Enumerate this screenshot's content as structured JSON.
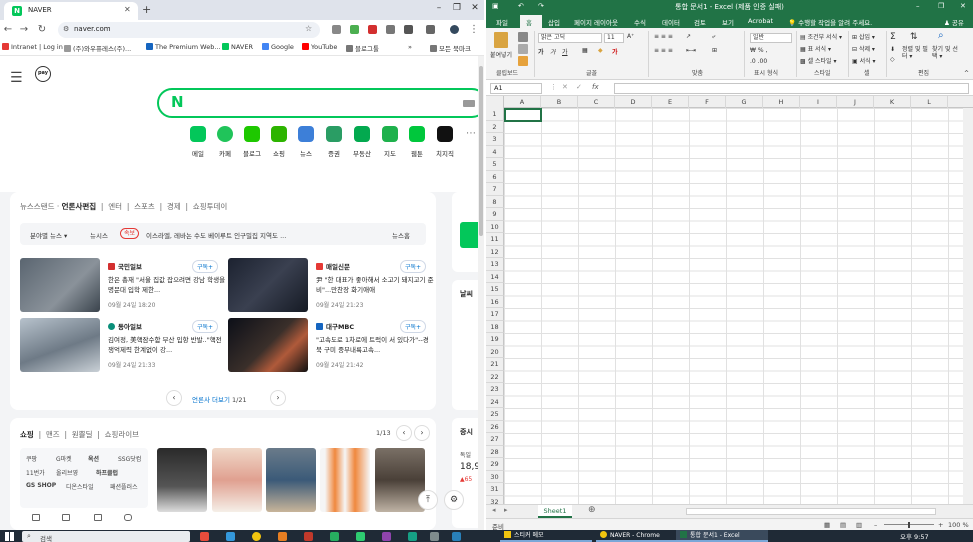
{
  "chrome": {
    "tab_title": "NAVER",
    "url": "naver.com",
    "bookmarks": [
      "Intranet | Log in",
      "(주)와우퓨레스(주)...",
      "The Premium Web...",
      "NAVER",
      "Google",
      "YouTube",
      "블로그툴",
      "모든 북마크"
    ]
  },
  "naver": {
    "services": [
      "메일",
      "카페",
      "블로그",
      "쇼핑",
      "뉴스",
      "증권",
      "부동산",
      "지도",
      "웹툰",
      "치지직"
    ],
    "news_tabs": [
      "뉴스스탠드",
      "언론사편집",
      "엔터",
      "스포츠",
      "경제",
      "쇼핑투데이"
    ],
    "ticker": {
      "label": "분야별 뉴스 ▾",
      "source": "뉴시스",
      "badge": "속보",
      "text": "이스라엘, 레바논 수도 베이루트 인구밀집 지역도 ...",
      "right": "뉴스홈"
    },
    "cards": [
      {
        "pub": "국민일보",
        "sub": "구독+",
        "headline": "한은 총재 \"서울 집값 잡으려면 강남 학생을 명문대 입학 제한...",
        "date": "09월 24일 18:20"
      },
      {
        "pub": "매일신문",
        "sub": "구독+",
        "headline": "尹 \"한 대표가 좋아해서 소고기 돼지고기 준비\"...만찬장 화기애애",
        "date": "09월 24일 21:23"
      },
      {
        "pub": "동아일보",
        "sub": "구독+",
        "headline": "김여정, 美핵잠수함 부산 입항 반발..\"핵전쟁억제력 한계없이 강...",
        "date": "09월 24일 21:33"
      },
      {
        "pub": "대구MBC",
        "sub": "구독+",
        "headline": "\"고속도로 1차로에 트럭이 서 있다가\"--경북 구미 중부내륙고속...",
        "date": "09월 24일 21:42"
      }
    ],
    "pager": {
      "label": "언론사 더보기",
      "page": "1/21"
    },
    "shop_tabs": [
      "쇼핑",
      "맨즈",
      "원쁠딜",
      "쇼핑라이브"
    ],
    "shop_count": "1/13",
    "shop_categories": [
      [
        "쿠팡",
        "G마켓",
        "옥션",
        "SSG닷컴"
      ],
      [
        "11번가",
        "올리브영",
        "하프클럽",
        ""
      ],
      [
        "GS SHOP",
        "디온스타일",
        "패션플러스",
        ""
      ]
    ],
    "right_labels": [
      "날씨",
      "증시",
      "독일",
      "18,9",
      "▲65"
    ]
  },
  "excel": {
    "title": "통합 문서1 - Excel (제품 인증 실패)",
    "menu": [
      "파일",
      "홈",
      "삽입",
      "페이지 레이아웃",
      "수식",
      "데이터",
      "검토",
      "보기",
      "Acrobat"
    ],
    "tell_me": "수행할 작업을 알려 주세요.",
    "share": "공유",
    "font_name": "맑은 고딕",
    "font_size": "11",
    "number_format": "일반",
    "paste_label": "붙여넣기",
    "groups": [
      "클립보드",
      "글꼴",
      "맞춤",
      "표시 형식",
      "스타일",
      "셀",
      "편집"
    ],
    "style_items": [
      "조건부 서식 ▾",
      "표 서식 ▾",
      "셀 스타일 ▾"
    ],
    "cell_items": [
      "삽입 ▾",
      "삭제 ▾",
      "서식 ▾"
    ],
    "edit_items": [
      "정렬 및 필터 ▾",
      "찾기 및 선택 ▾"
    ],
    "name_box": "A1",
    "fx": "fx",
    "columns": [
      "A",
      "B",
      "C",
      "D",
      "E",
      "F",
      "G",
      "H",
      "I",
      "J",
      "K",
      "L"
    ],
    "rows": [
      "1",
      "2",
      "3",
      "4",
      "5",
      "6",
      "7",
      "8",
      "9",
      "10",
      "11",
      "12",
      "13",
      "14",
      "15",
      "16",
      "17",
      "18",
      "19",
      "20",
      "21",
      "22",
      "23",
      "24",
      "25",
      "26",
      "27",
      "28",
      "29",
      "30",
      "31",
      "32"
    ],
    "sheet_tab": "Sheet1",
    "status_left": "준비",
    "zoom": "100 %"
  },
  "taskbar": {
    "search_placeholder": "검색",
    "apps": [
      "스티커 메모",
      "NAVER - Chrome",
      "통합 문서1 - Excel"
    ],
    "time": "오후 9:57"
  }
}
